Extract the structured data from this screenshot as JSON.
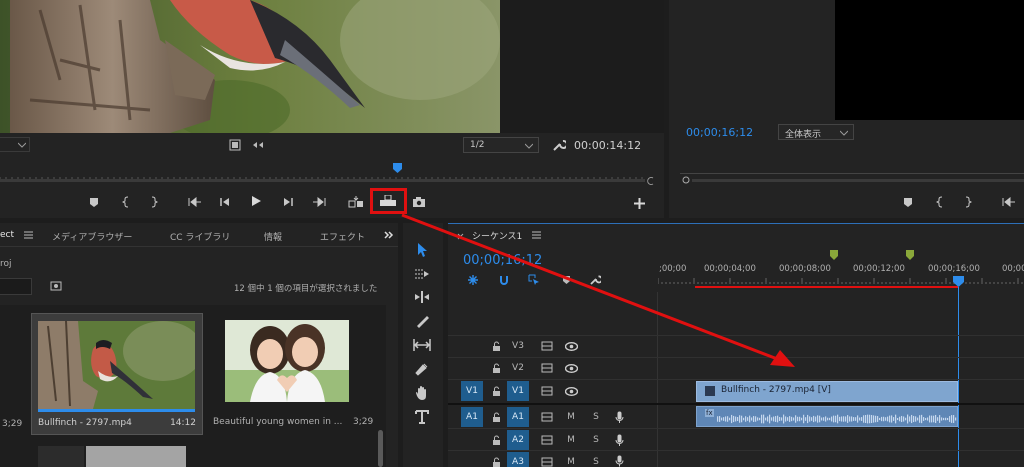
{
  "source_monitor": {
    "zoom_value": "1/2",
    "timecode": "00:00:14:12"
  },
  "program_monitor": {
    "timecode": "00;00;16;12",
    "zoom_value": "全体表示"
  },
  "project_panel": {
    "tabs": [
      "ect",
      "メディアブラウザー",
      "CC ライブラリ",
      "情報",
      "エフェクト"
    ],
    "project_name": "roj",
    "selection_status": "12 個中 1 個の項目が選択されました",
    "items": [
      {
        "name": "Bullfinch - 2797.mp4",
        "duration": "14:12"
      },
      {
        "name": "Beautiful young women in ...",
        "duration": "3;29"
      }
    ],
    "left_edge_durations": [
      "3;29",
      "3;29"
    ]
  },
  "timeline": {
    "tab_label": "シーケンス1",
    "timecode": "00;00;16;12",
    "ruler_labels": [
      ";00;00",
      "00;00;04;00",
      "00;00;08;00",
      "00;00;12;00",
      "00;00;16;00",
      "00;00;2"
    ],
    "video_tracks": [
      {
        "label": "V3"
      },
      {
        "label": "V2"
      },
      {
        "label": "V1",
        "source": "V1"
      }
    ],
    "audio_tracks": [
      {
        "label": "A1",
        "source": "A1",
        "m": "M",
        "s": "S"
      },
      {
        "label": "A2",
        "m": "M",
        "s": "S"
      },
      {
        "label": "A3",
        "m": "M",
        "s": "S"
      }
    ],
    "video_clip": "Bullfinch - 2797.mp4 [V]",
    "audio_clip_badge": "fx"
  },
  "colors": {
    "accent_blue": "#2d8ceb",
    "highlight_red": "#e01010",
    "clip_video": "#7fa5cf",
    "clip_audio": "#5f87b6",
    "marker_green": "#8aa83a"
  }
}
